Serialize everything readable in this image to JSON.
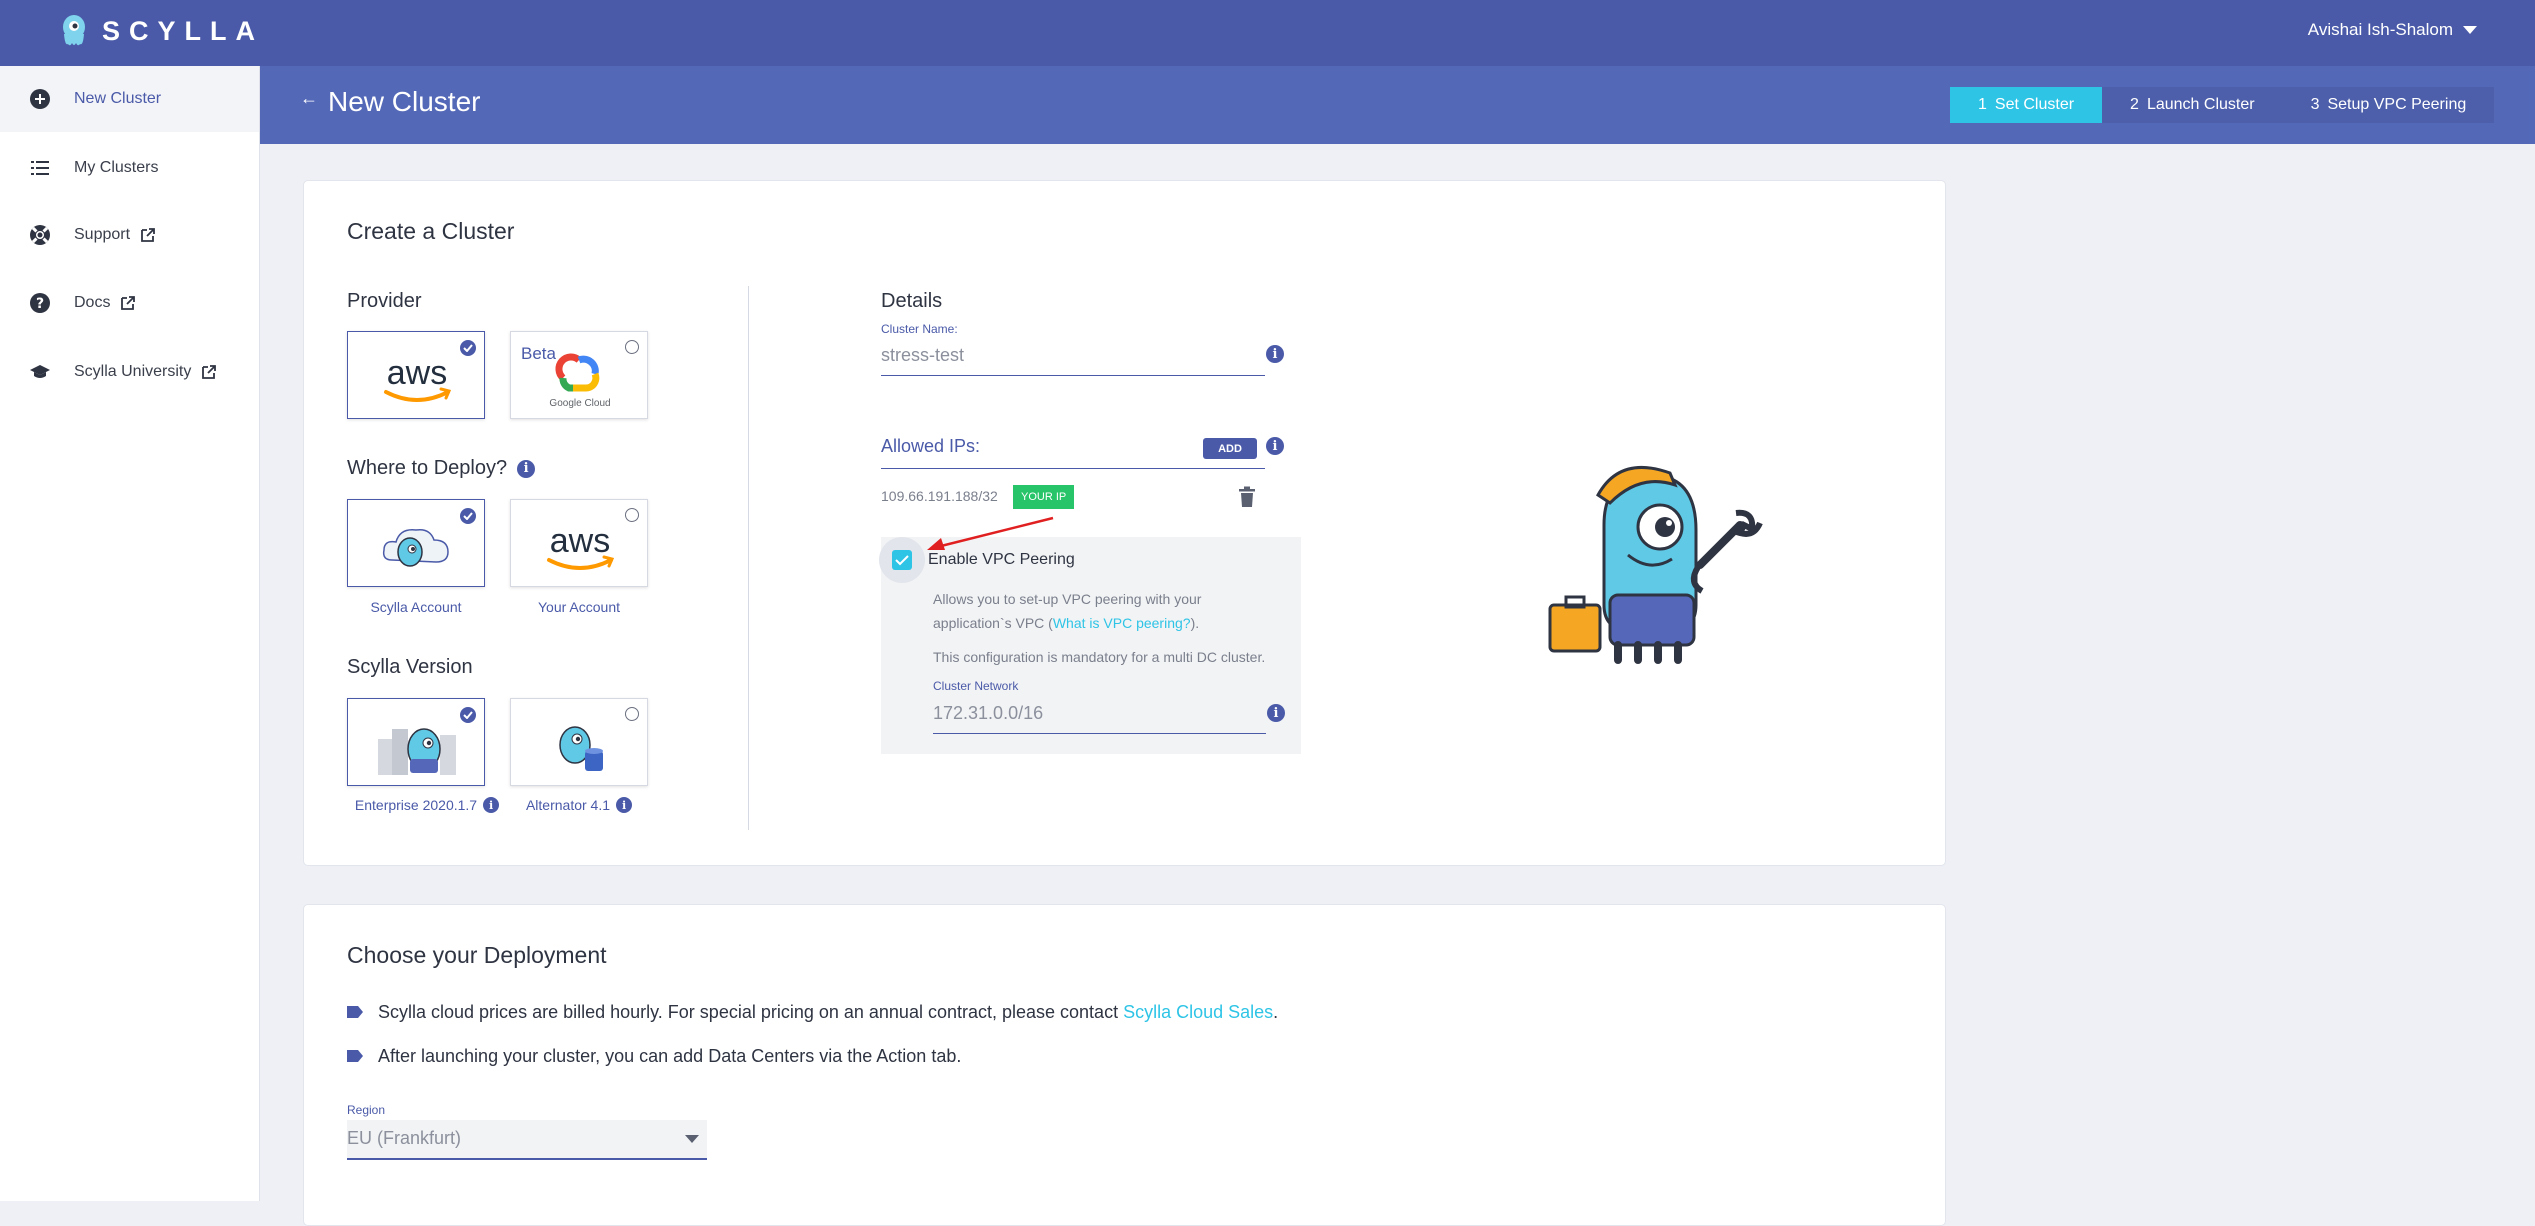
{
  "app": {
    "logo_text": "SCYLLA",
    "user_name": "Avishai Ish-Shalom"
  },
  "sidebar": {
    "items": [
      {
        "label": "New Cluster",
        "icon": "plus-circle-icon",
        "active": true
      },
      {
        "label": "My Clusters",
        "icon": "list-icon"
      },
      {
        "label": "Support",
        "icon": "lifebuoy-icon",
        "external": true
      },
      {
        "label": "Docs",
        "icon": "help-circle-icon",
        "external": true
      },
      {
        "label": "Scylla University",
        "icon": "graduation-cap-icon",
        "external": true
      }
    ]
  },
  "header": {
    "back_icon": "←",
    "title": "New Cluster",
    "steps": [
      {
        "num": "1",
        "label": "Set Cluster",
        "active": true
      },
      {
        "num": "2",
        "label": "Launch Cluster"
      },
      {
        "num": "3",
        "label": "Setup VPC Peering"
      }
    ]
  },
  "create": {
    "title": "Create a Cluster",
    "provider": {
      "label": "Provider",
      "options": [
        {
          "name": "aws",
          "selected": true
        },
        {
          "name": "Google Cloud",
          "badge": "Beta",
          "selected": false
        }
      ]
    },
    "deploy": {
      "label": "Where to Deploy?",
      "options": [
        {
          "caption": "Scylla Account",
          "selected": true
        },
        {
          "caption": "Your Account",
          "logo": "aws",
          "selected": false
        }
      ]
    },
    "version": {
      "label": "Scylla Version",
      "options": [
        {
          "caption": "Enterprise 2020.1.7",
          "selected": true
        },
        {
          "caption": "Alternator 4.1",
          "selected": false
        }
      ]
    },
    "details": {
      "title": "Details",
      "cluster_name_label": "Cluster Name:",
      "cluster_name_value": "stress-test",
      "allowed_ips_label": "Allowed IPs:",
      "add_label": "ADD",
      "ip": "109.66.191.188/32",
      "ip_badge": "YOUR IP",
      "vpc_label": "Enable VPC Peering",
      "vpc_checked": true,
      "vpc_desc_1": "Allows you to set-up VPC peering with your",
      "vpc_desc_2_pre": "application`s VPC (",
      "vpc_desc_link": "What is VPC peering?",
      "vpc_desc_2_post": ").",
      "vpc_desc_3": "This configuration is mandatory for a multi DC cluster.",
      "network_label": "Cluster Network",
      "network_value": "172.31.0.0/16"
    }
  },
  "deployment": {
    "title": "Choose your Deployment",
    "line1_pre": "Scylla cloud prices are billed hourly. For special pricing on an annual contract, please contact ",
    "line1_link": "Scylla Cloud Sales",
    "line1_post": ".",
    "line2": "After launching your cluster, you can add Data Centers via the Action tab.",
    "region_label": "Region",
    "region_value": "EU (Frankfurt)"
  },
  "colors": {
    "brand": "#4a5aa8",
    "accent": "#2ec4e6",
    "badge_green": "#28c46a"
  }
}
